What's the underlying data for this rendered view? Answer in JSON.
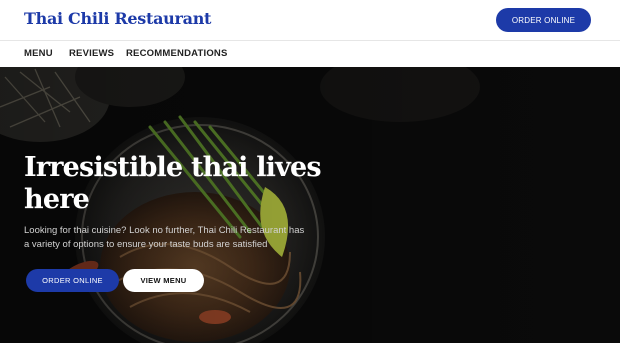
{
  "header": {
    "brand": "Thai Chili Restaurant",
    "order_button": "ORDER ONLINE"
  },
  "nav": {
    "items": [
      {
        "label": "MENU"
      },
      {
        "label": "REVIEWS"
      },
      {
        "label": "RECOMMENDATIONS"
      }
    ]
  },
  "hero": {
    "title": "Irresistible thai lives here",
    "description": "Looking for thai cuisine? Look no further, Thai Chili Restaurant has a variety of options to ensure your taste buds are satisfied",
    "order_button": "ORDER ONLINE",
    "menu_button": "VIEW MENU"
  },
  "colors": {
    "brand": "#1d3aa8",
    "hero_overlay": "#0b0b0b",
    "text_light": "#ffffff"
  }
}
